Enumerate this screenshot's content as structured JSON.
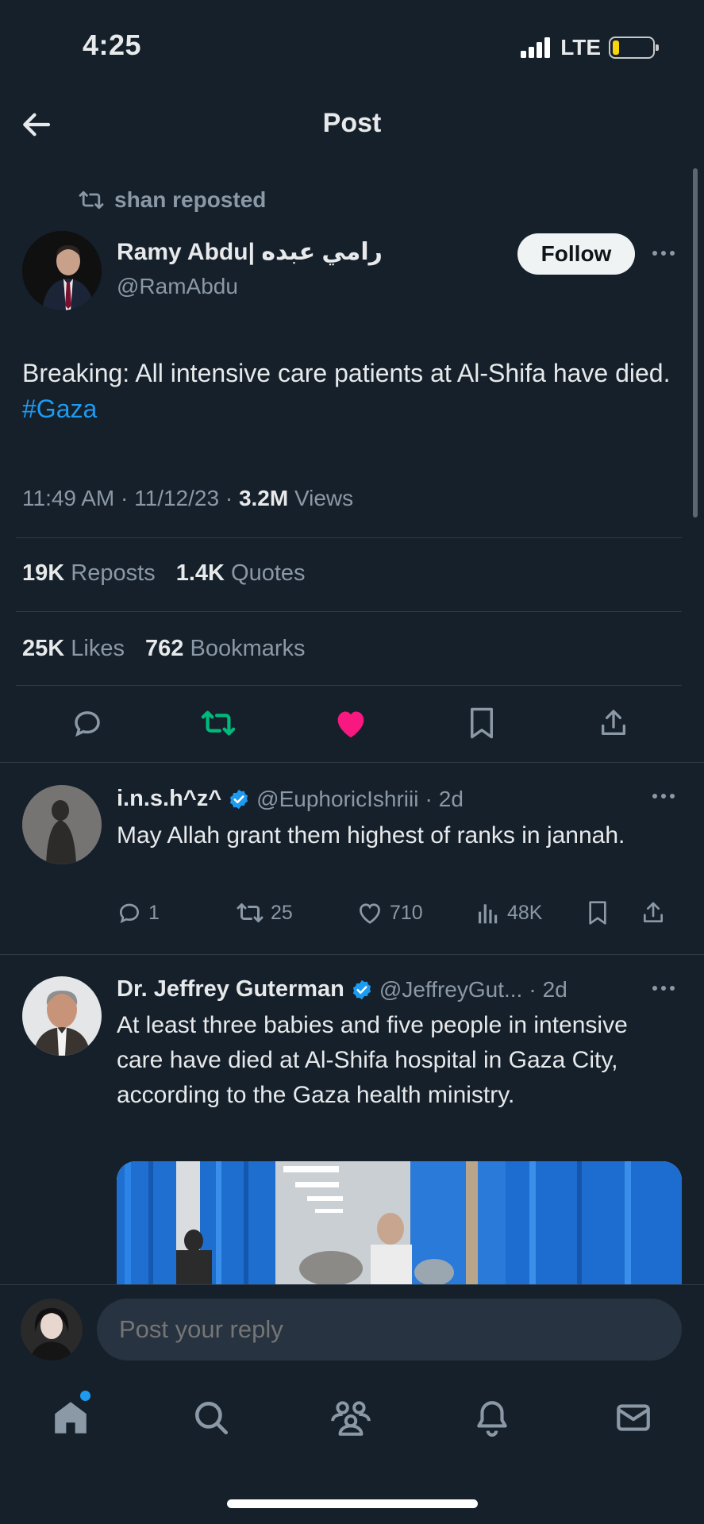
{
  "status_bar": {
    "time": "4:25",
    "network": "LTE"
  },
  "header": {
    "title": "Post"
  },
  "main_post": {
    "repost_label": "shan reposted",
    "author_name": "Ramy Abdu| رامي عبده",
    "author_handle": "@RamAbdu",
    "follow_label": "Follow",
    "text_before": "Breaking: All intensive care patients at Al-Shifa have died. ",
    "hashtag": "#Gaza",
    "time": "11:49 AM",
    "date": "11/12/23",
    "views_count": "3.2M",
    "views_label": "Views",
    "reposts_count": "19K",
    "reposts_label": "Reposts",
    "quotes_count": "1.4K",
    "quotes_label": "Quotes",
    "likes_count": "25K",
    "likes_label": "Likes",
    "bookmarks_count": "762",
    "bookmarks_label": "Bookmarks",
    "actions": [
      "reply-icon",
      "repost-icon",
      "like-icon",
      "bookmark-icon",
      "share-icon"
    ],
    "colors": {
      "repost": "#00ba7c",
      "like": "#f91880",
      "link": "#1d9bf0"
    }
  },
  "replies": [
    {
      "name": "i.n.s.h^z^",
      "handle": "@EuphoricIshriii",
      "age": "2d",
      "text": "May Allah grant them highest of ranks in jannah.",
      "replies": "1",
      "reposts": "25",
      "likes": "710",
      "views": "48K"
    },
    {
      "name": "Dr. Jeffrey Guterman",
      "handle": "@JeffreyGut...",
      "age": "2d",
      "text": "At least three babies and five people in intensive care have died at Al-Shifa hospital in Gaza City, according to the Gaza health ministry."
    }
  ],
  "compose": {
    "placeholder": "Post your reply"
  },
  "tab_bar": [
    "home-icon",
    "search-icon",
    "communities-icon",
    "notifications-icon",
    "messages-icon"
  ]
}
